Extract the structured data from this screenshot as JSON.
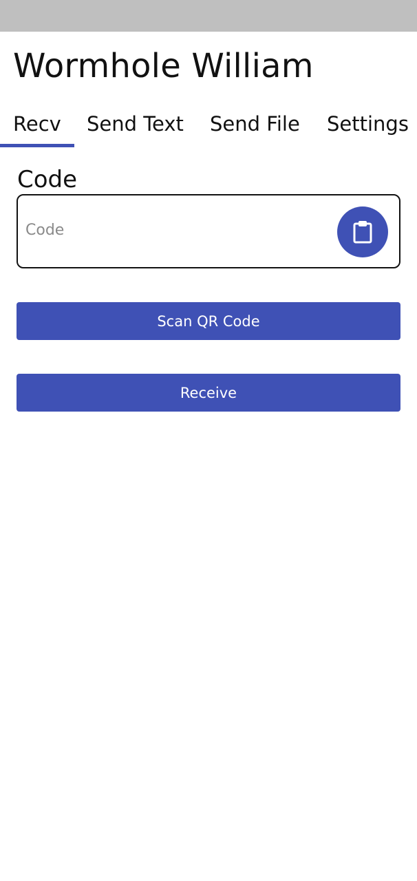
{
  "app": {
    "title": "Wormhole William"
  },
  "tabs": [
    {
      "label": "Recv",
      "selected": true
    },
    {
      "label": "Send Text",
      "selected": false
    },
    {
      "label": "Send File",
      "selected": false
    },
    {
      "label": "Settings",
      "selected": false
    }
  ],
  "recv": {
    "code_label": "Code",
    "code_input": {
      "value": "",
      "placeholder": "Code"
    },
    "paste_icon": "clipboard-icon",
    "scan_button_label": "Scan QR Code",
    "receive_button_label": "Receive"
  },
  "colors": {
    "accent": "#3f51b5",
    "status_bar": "#bfbfbf",
    "text": "#111111",
    "placeholder": "#8a8a8a"
  }
}
